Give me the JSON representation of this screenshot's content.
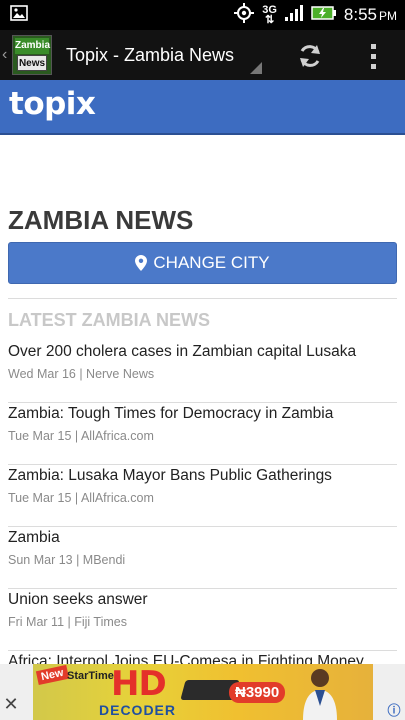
{
  "status_bar": {
    "network": "3G",
    "time": "8:55",
    "ampm": "PM"
  },
  "action_bar": {
    "logo_top": "Zambia",
    "logo_bottom": "News",
    "title": "Topix - Zambia News"
  },
  "header": {
    "logo": "topix"
  },
  "page": {
    "title": "ZAMBIA NEWS",
    "change_city_label": "CHANGE CITY",
    "section_heading": "LATEST ZAMBIA NEWS"
  },
  "news": [
    {
      "headline": "Over 200 cholera cases in Zambian capital Lusaka",
      "meta": "Wed Mar 16 | Nerve News"
    },
    {
      "headline": "Zambia: Tough Times for Democracy in Zambia",
      "meta": "Tue Mar 15 | AllAfrica.com"
    },
    {
      "headline": "Zambia: Lusaka Mayor Bans Public Gatherings",
      "meta": "Tue Mar 15 | AllAfrica.com"
    },
    {
      "headline": "Zambia",
      "meta": "Sun Mar 13 | MBendi"
    },
    {
      "headline": "Union seeks answer",
      "meta": "Fri Mar 11 | Fiji Times"
    },
    {
      "headline": "Africa: Interpol Joins EU-Comesa in Fighting Money",
      "meta": ""
    }
  ],
  "ad": {
    "new_label": "New",
    "brand": "StarTimes",
    "hd": "HD",
    "decoder": "DECODER",
    "price": "₦3990",
    "close": "✕"
  },
  "icons": {
    "gallery": "image-icon",
    "gps": "gps-icon",
    "signal": "signal-icon",
    "battery": "battery-charging-icon",
    "refresh": "refresh-icon",
    "overflow": "overflow-menu-icon",
    "location": "location-pin-icon"
  },
  "colors": {
    "topix_blue": "#3d6cc1",
    "button_blue": "#4b79c9",
    "section_gray": "#c8c8c8",
    "battery_green": "#4caf2a"
  }
}
